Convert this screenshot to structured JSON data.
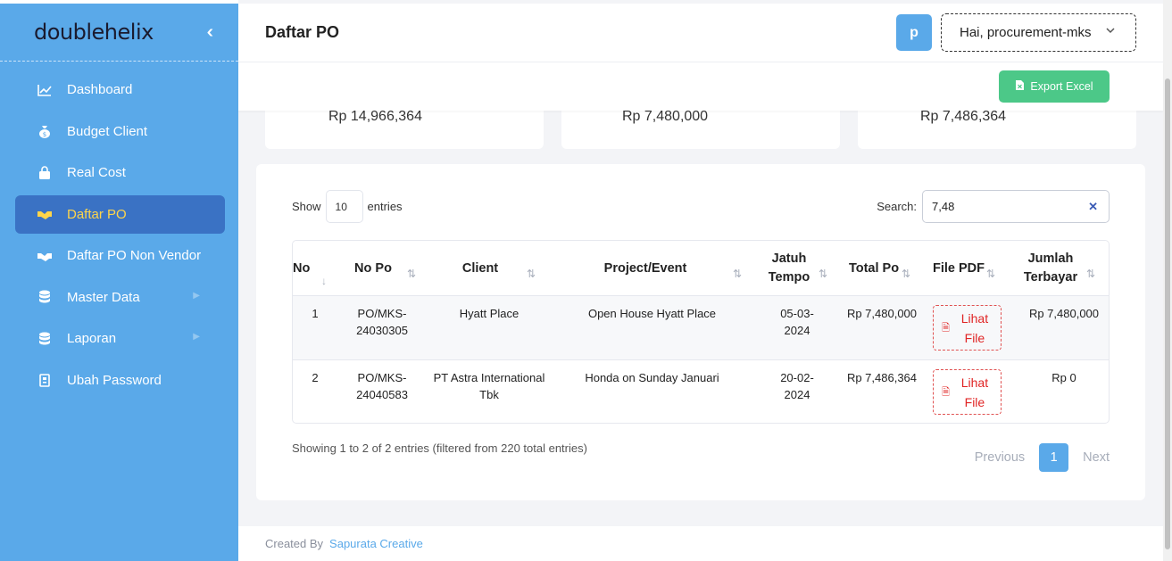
{
  "brand": {
    "name": "doublehelix"
  },
  "sidebar": {
    "items": [
      {
        "label": "Dashboard",
        "icon": "chart-line-icon"
      },
      {
        "label": "Budget Client",
        "icon": "money-bag-icon"
      },
      {
        "label": "Real Cost",
        "icon": "shopping-bag-icon"
      },
      {
        "label": "Daftar PO",
        "icon": "handshake-icon",
        "active": true
      },
      {
        "label": "Daftar PO Non Vendor",
        "icon": "handshake-icon"
      },
      {
        "label": "Master Data",
        "icon": "database-icon",
        "has_submenu": true
      },
      {
        "label": "Laporan",
        "icon": "database-icon",
        "has_submenu": true
      },
      {
        "label": "Ubah Password",
        "icon": "clipboard-icon"
      }
    ]
  },
  "header": {
    "title": "Daftar PO",
    "avatar_letter": "p",
    "user_greeting": "Hai, procurement-mks"
  },
  "toolbar": {
    "export_label": "Export Excel"
  },
  "stats": [
    {
      "value": "Rp 14,966,364"
    },
    {
      "value": "Rp 7,480,000"
    },
    {
      "value": "Rp 7,486,364"
    }
  ],
  "table_controls": {
    "show_label": "Show",
    "entries_value": "10",
    "entries_label": "entries",
    "search_label": "Search:",
    "search_value": "7,48"
  },
  "table": {
    "columns": [
      "No",
      "No Po",
      "Client",
      "Project/Event",
      "Jatuh Tempo",
      "Total Po",
      "File PDF",
      "Jumlah Terbayar"
    ],
    "rows": [
      {
        "no": "1",
        "no_po": "PO/MKS-24030305",
        "client": "Hyatt Place",
        "project": "Open House Hyatt Place",
        "jatuh_tempo": "05-03-2024",
        "total_po": "Rp 7,480,000",
        "file": "Lihat File",
        "terbayar": "Rp 7,480,000"
      },
      {
        "no": "2",
        "no_po": "PO/MKS-24040583",
        "client": "PT Astra International Tbk",
        "project": "Honda on Sunday Januari",
        "jatuh_tempo": "20-02-2024",
        "total_po": "Rp 7,486,364",
        "file": "Lihat File",
        "terbayar": "Rp 0"
      }
    ]
  },
  "pagination": {
    "info": "Showing 1 to 2 of 2 entries (filtered from 220 total entries)",
    "previous": "Previous",
    "current": "1",
    "next": "Next"
  },
  "footer": {
    "prefix": "Created By",
    "company": "Sapurata Creative"
  },
  "colors": {
    "sidebar": "#5aa9e9",
    "active_item": "#3a72c4",
    "active_text": "#ffd54a",
    "export_button": "#4cc888",
    "pdf_red": "#e02424"
  }
}
